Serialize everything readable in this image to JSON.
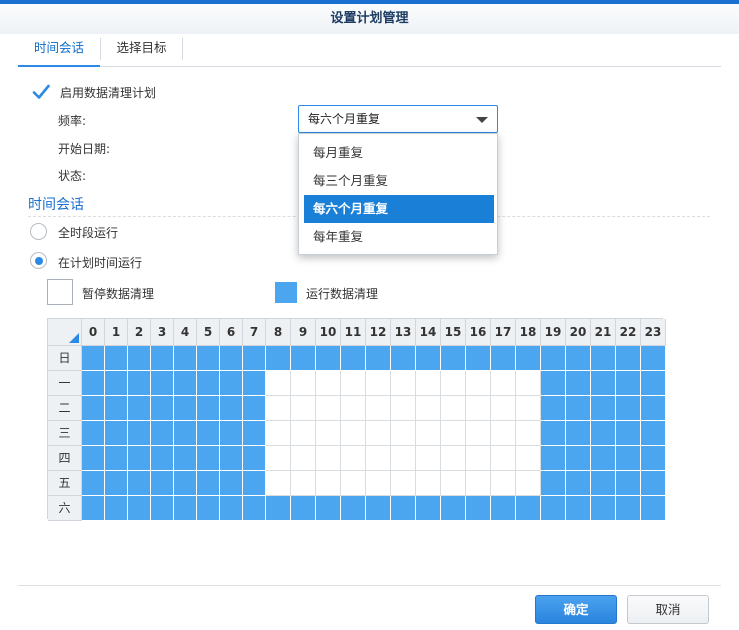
{
  "window": {
    "title": "设置计划管理"
  },
  "tabs": [
    {
      "label": "时间会话",
      "active": true
    },
    {
      "label": "选择目标",
      "active": false
    }
  ],
  "enable": {
    "label": "启用数据清理计划",
    "checked": true
  },
  "fields": {
    "frequency_label": "频率:",
    "frequency_value": "每六个月重复",
    "start_date_label": "开始日期:",
    "status_label": "状态:"
  },
  "frequency_options": [
    "每月重复",
    "每三个月重复",
    "每六个月重复",
    "每年重复"
  ],
  "frequency_selected_index": 2,
  "section": {
    "title": "时间会话"
  },
  "run_mode": {
    "options": [
      {
        "label": "全时段运行",
        "selected": false
      },
      {
        "label": "在计划时间运行",
        "selected": true
      }
    ]
  },
  "legend": {
    "pause_label": "暂停数据清理",
    "run_label": "运行数据清理"
  },
  "schedule": {
    "hours": [
      "0",
      "1",
      "2",
      "3",
      "4",
      "5",
      "6",
      "7",
      "8",
      "9",
      "10",
      "11",
      "12",
      "13",
      "14",
      "15",
      "16",
      "17",
      "18",
      "19",
      "20",
      "21",
      "22",
      "23"
    ],
    "days": [
      "日",
      "一",
      "二",
      "三",
      "四",
      "五",
      "六"
    ],
    "grid": [
      [
        1,
        1,
        1,
        1,
        1,
        1,
        1,
        1,
        1,
        1,
        1,
        1,
        1,
        1,
        1,
        1,
        1,
        1,
        1,
        1,
        1,
        1,
        1,
        1
      ],
      [
        1,
        1,
        1,
        1,
        1,
        1,
        1,
        1,
        0,
        0,
        0,
        0,
        0,
        0,
        0,
        0,
        0,
        0,
        0,
        1,
        1,
        1,
        1,
        1
      ],
      [
        1,
        1,
        1,
        1,
        1,
        1,
        1,
        1,
        0,
        0,
        0,
        0,
        0,
        0,
        0,
        0,
        0,
        0,
        0,
        1,
        1,
        1,
        1,
        1
      ],
      [
        1,
        1,
        1,
        1,
        1,
        1,
        1,
        1,
        0,
        0,
        0,
        0,
        0,
        0,
        0,
        0,
        0,
        0,
        0,
        1,
        1,
        1,
        1,
        1
      ],
      [
        1,
        1,
        1,
        1,
        1,
        1,
        1,
        1,
        0,
        0,
        0,
        0,
        0,
        0,
        0,
        0,
        0,
        0,
        0,
        1,
        1,
        1,
        1,
        1
      ],
      [
        1,
        1,
        1,
        1,
        1,
        1,
        1,
        1,
        0,
        0,
        0,
        0,
        0,
        0,
        0,
        0,
        0,
        0,
        0,
        1,
        1,
        1,
        1,
        1
      ],
      [
        1,
        1,
        1,
        1,
        1,
        1,
        1,
        1,
        1,
        1,
        1,
        1,
        1,
        1,
        1,
        1,
        1,
        1,
        1,
        1,
        1,
        1,
        1,
        1
      ]
    ]
  },
  "buttons": {
    "ok": "确定",
    "cancel": "取消"
  },
  "colors": {
    "accent": "#2a8ae6",
    "run_cell": "#4ba6ef",
    "title_blue": "#1a6fd0"
  }
}
